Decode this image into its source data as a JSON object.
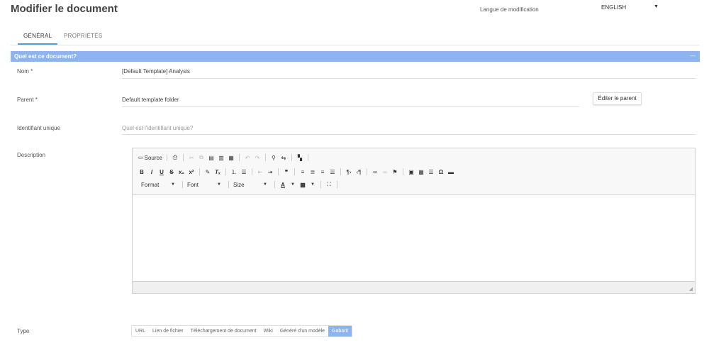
{
  "page": {
    "title": "Modifier le document"
  },
  "language": {
    "label": "Langue de modification",
    "value": "ENGLISH"
  },
  "tabs": [
    {
      "label": "GÉNÉRAL",
      "active": true
    },
    {
      "label": "PROPRIÉTÉS",
      "active": false
    }
  ],
  "section": {
    "title": "Quel est ce document?",
    "collapse": "—"
  },
  "fields": {
    "name": {
      "label": "Nom *",
      "value": "[Default Template] Analysis"
    },
    "parent": {
      "label": "Parent  *",
      "value": "Default template folder",
      "button": "Éditer le parent"
    },
    "unique_id": {
      "label": "Identifiant unique",
      "placeholder": "Quel est l'identifiant unique?"
    },
    "description": {
      "label": "Description"
    },
    "type": {
      "label": "Type"
    }
  },
  "editor": {
    "source_label": "Source",
    "format_label": "Format",
    "font_label": "Font",
    "size_label": "Size"
  },
  "type_options": [
    {
      "label": "URL",
      "active": false
    },
    {
      "label": "Lien de fichier",
      "active": false
    },
    {
      "label": "Téléchargement de document",
      "active": false
    },
    {
      "label": "Wiki",
      "active": false
    },
    {
      "label": "Généré d'un modèle",
      "active": false
    },
    {
      "label": "Gabarit",
      "active": true
    }
  ],
  "colors": {
    "accent": "#8db4f0",
    "tab_underline": "#5b9bd5"
  }
}
